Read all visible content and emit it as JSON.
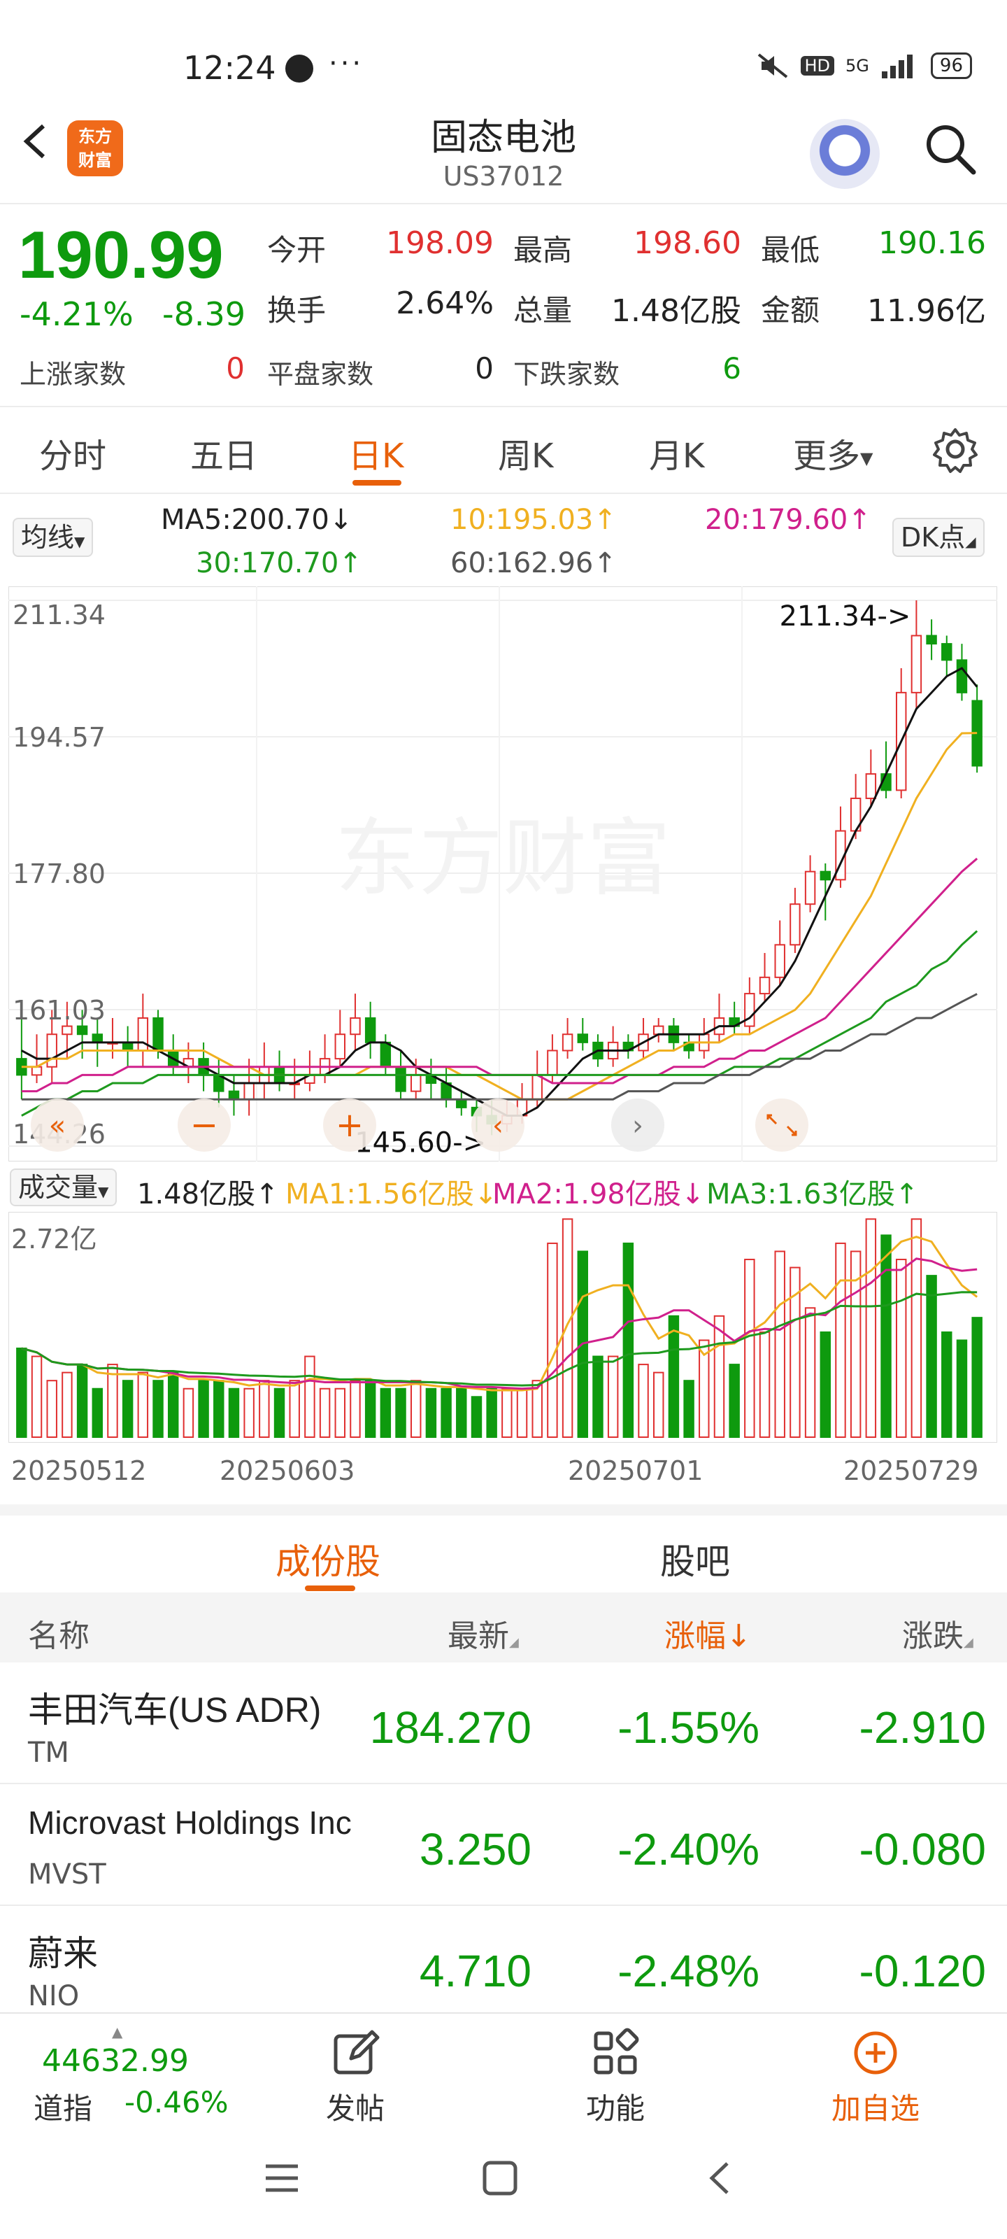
{
  "status": {
    "time": "12:24",
    "dots": "···",
    "hd": "HD",
    "network": "5G",
    "battery": "96"
  },
  "header": {
    "title": "固态电池",
    "code": "US37012",
    "logo_text": "东方财富"
  },
  "quote": {
    "price": "190.99",
    "change_pct": "-4.21%",
    "change": "-8.39",
    "open_label": "今开",
    "open": "198.09",
    "high_label": "最高",
    "high": "198.60",
    "low_label": "最低",
    "low": "190.16",
    "turnover_label": "换手",
    "turnover": "2.64%",
    "volume_label": "总量",
    "volume": "1.48亿股",
    "amount_label": "金额",
    "amount": "11.96亿",
    "up_label": "上涨家数",
    "up": "0",
    "flat_label": "平盘家数",
    "flat": "0",
    "down_label": "下跌家数",
    "down": "6"
  },
  "tabs": [
    "分时",
    "五日",
    "日K",
    "周K",
    "月K",
    "更多"
  ],
  "active_tab": "日K",
  "ma_legend": {
    "selector": "均线",
    "ma5": "MA5:200.70↓",
    "ma10": "10:195.03↑",
    "ma20": "20:179.60↑",
    "ma30": "30:170.70↑",
    "ma60": "60:162.96↑",
    "dk": "DK点"
  },
  "colors": {
    "up": "#e03030",
    "down": "#0e9a0e",
    "accent": "#e8600a",
    "ma5": "#111111",
    "ma10": "#f0b020",
    "ma20": "#d0208c",
    "ma30": "#1e9a1e",
    "ma60": "#555555"
  },
  "chart_data": [
    {
      "type": "candlestick",
      "y_ticks": [
        "211.34",
        "194.57",
        "177.80",
        "161.03",
        "144.26"
      ],
      "ylim": [
        144.26,
        211.34
      ],
      "x_ticks": [
        "20250512",
        "20250603",
        "20250701",
        "20250729"
      ],
      "annotations": {
        "high": "211.34->",
        "low": "145.60->"
      },
      "watermark": "东方财富",
      "candles": [
        [
          155,
          153,
          160,
          150
        ],
        [
          153,
          154,
          158,
          152
        ],
        [
          154,
          158,
          161,
          152
        ],
        [
          158,
          159,
          162,
          155
        ],
        [
          159,
          158,
          161,
          155
        ],
        [
          158,
          157,
          160,
          154
        ],
        [
          157,
          157,
          160,
          155
        ],
        [
          157,
          156,
          159,
          154
        ],
        [
          156,
          160,
          163,
          154
        ],
        [
          160,
          156,
          161,
          155
        ],
        [
          156,
          154,
          158,
          153
        ],
        [
          154,
          155,
          157,
          152
        ],
        [
          155,
          153,
          157,
          151
        ],
        [
          153,
          151,
          155,
          149
        ],
        [
          151,
          150,
          153,
          148
        ],
        [
          150,
          152,
          155,
          148
        ],
        [
          152,
          154,
          157,
          150
        ],
        [
          154,
          152,
          156,
          151
        ],
        [
          152,
          152,
          155,
          150
        ],
        [
          152,
          153,
          156,
          151
        ],
        [
          153,
          155,
          158,
          152
        ],
        [
          155,
          158,
          161,
          154
        ],
        [
          158,
          160,
          163,
          156
        ],
        [
          160,
          157,
          162,
          155
        ],
        [
          157,
          154,
          158,
          153
        ],
        [
          154,
          151,
          156,
          150
        ],
        [
          151,
          153,
          155,
          150
        ],
        [
          153,
          152,
          155,
          150
        ],
        [
          152,
          150,
          154,
          149
        ],
        [
          150,
          149,
          151,
          148
        ],
        [
          149,
          148,
          150,
          146
        ],
        [
          148,
          147,
          150,
          145.6
        ],
        [
          147,
          148,
          150,
          146
        ],
        [
          148,
          150,
          152,
          147
        ],
        [
          150,
          153,
          156,
          149
        ],
        [
          153,
          156,
          158,
          152
        ],
        [
          156,
          158,
          160,
          155
        ],
        [
          158,
          157,
          160,
          156
        ],
        [
          157,
          155,
          158,
          154
        ],
        [
          155,
          157,
          159,
          154
        ],
        [
          157,
          156,
          158,
          155
        ],
        [
          156,
          158,
          160,
          155
        ],
        [
          158,
          159,
          160,
          157
        ],
        [
          159,
          157,
          160,
          156
        ],
        [
          157,
          156,
          158,
          155
        ],
        [
          156,
          158,
          160,
          155
        ],
        [
          158,
          160,
          163,
          157
        ],
        [
          160,
          159,
          162,
          158
        ],
        [
          159,
          163,
          165,
          158
        ],
        [
          163,
          165,
          168,
          162
        ],
        [
          165,
          169,
          172,
          164
        ],
        [
          169,
          174,
          176,
          168
        ],
        [
          174,
          178,
          180,
          173
        ],
        [
          178,
          177,
          179,
          172
        ],
        [
          177,
          183,
          186,
          176
        ],
        [
          183,
          187,
          190,
          182
        ],
        [
          187,
          190,
          193,
          186
        ],
        [
          190,
          188,
          194,
          187
        ],
        [
          188,
          200,
          203,
          187
        ],
        [
          200,
          207,
          211.34,
          198
        ],
        [
          207,
          206,
          209,
          204
        ],
        [
          206,
          204,
          207,
          202
        ],
        [
          204,
          200,
          206,
          199
        ],
        [
          199,
          191,
          201,
          190.16
        ]
      ],
      "ma_lines": {
        "MA5": [
          156,
          155,
          155,
          156,
          157,
          157,
          157,
          157,
          157,
          156,
          155,
          154,
          154,
          153,
          152,
          152,
          152,
          152,
          152,
          153,
          153,
          154,
          156,
          157,
          157,
          156,
          154,
          153,
          152,
          151,
          150,
          149,
          148,
          148,
          149,
          151,
          153,
          155,
          156,
          156,
          156,
          157,
          158,
          158,
          158,
          158,
          159,
          159,
          160,
          162,
          164,
          167,
          171,
          175,
          179,
          183,
          186,
          190,
          194,
          198,
          200,
          202,
          203,
          200.7
        ],
        "MA10": [
          154,
          154,
          155,
          155,
          156,
          156,
          156,
          156,
          156,
          156,
          156,
          156,
          156,
          155,
          154,
          154,
          153,
          153,
          153,
          153,
          153,
          153,
          153,
          154,
          154,
          154,
          154,
          154,
          154,
          153,
          153,
          152,
          151,
          150,
          150,
          150,
          150,
          151,
          152,
          153,
          154,
          155,
          156,
          156,
          157,
          157,
          157,
          158,
          158,
          159,
          160,
          161,
          163,
          166,
          169,
          172,
          175,
          179,
          183,
          187,
          190,
          193,
          195,
          195.03
        ],
        "MA20": [
          151,
          151,
          152,
          152,
          153,
          153,
          153,
          154,
          154,
          154,
          154,
          154,
          154,
          154,
          154,
          154,
          154,
          154,
          154,
          154,
          154,
          154,
          154,
          154,
          154,
          154,
          154,
          154,
          154,
          154,
          154,
          153,
          153,
          153,
          153,
          152,
          152,
          152,
          152,
          152,
          153,
          153,
          153,
          154,
          154,
          154,
          155,
          155,
          156,
          156,
          157,
          158,
          159,
          160,
          162,
          164,
          166,
          168,
          170,
          172,
          174,
          176,
          178,
          179.6
        ],
        "MA30": [
          148,
          149,
          150,
          150,
          151,
          151,
          152,
          152,
          152,
          153,
          153,
          153,
          153,
          153,
          153,
          153,
          153,
          153,
          153,
          153,
          153,
          153,
          153,
          153,
          153,
          153,
          153,
          153,
          153,
          153,
          153,
          153,
          153,
          153,
          153,
          153,
          153,
          153,
          153,
          153,
          153,
          153,
          153,
          153,
          153,
          153,
          153,
          154,
          154,
          154,
          155,
          155,
          156,
          157,
          158,
          159,
          160,
          162,
          163,
          164,
          166,
          167,
          169,
          170.7
        ],
        "MA60": [
          150,
          150,
          150,
          150,
          150,
          150,
          150,
          150,
          150,
          150,
          150,
          150,
          150,
          150,
          150,
          150,
          150,
          150,
          150,
          150,
          150,
          150,
          150,
          150,
          150,
          150,
          150,
          150,
          150,
          150,
          150,
          150,
          150,
          150,
          150,
          150,
          150,
          150,
          150,
          150,
          151,
          151,
          151,
          152,
          152,
          152,
          153,
          153,
          153,
          154,
          154,
          155,
          155,
          156,
          156,
          157,
          158,
          158,
          159,
          160,
          160,
          161,
          162,
          162.96
        ]
      }
    },
    {
      "type": "bar",
      "title": "成交量",
      "y_ticks": [
        "2.72亿"
      ],
      "ylim": [
        0,
        2.72
      ],
      "values": [
        1.1,
        1.0,
        0.7,
        0.8,
        0.9,
        0.6,
        0.9,
        0.7,
        0.8,
        0.7,
        0.8,
        0.6,
        0.7,
        0.7,
        0.6,
        0.6,
        0.7,
        0.6,
        0.7,
        1.0,
        0.6,
        0.6,
        0.7,
        0.7,
        0.6,
        0.6,
        0.7,
        0.6,
        0.6,
        0.6,
        0.5,
        0.6,
        0.6,
        0.6,
        0.7,
        2.4,
        2.7,
        2.3,
        1.0,
        1.0,
        2.4,
        0.9,
        0.8,
        1.5,
        0.7,
        1.2,
        1.5,
        0.9,
        2.2,
        1.3,
        2.3,
        2.1,
        1.6,
        1.3,
        2.4,
        2.3,
        2.7,
        2.5,
        2.2,
        2.7,
        2.0,
        1.3,
        1.2,
        1.48
      ]
    }
  ],
  "vol_legend": {
    "label": "成交量",
    "vol": "1.48亿股↑",
    "ma1": "MA1:1.56亿股↓",
    "ma2": "MA2:1.98亿股↓",
    "ma3": "MA3:1.63亿股↑"
  },
  "section_tabs": [
    "成份股",
    "股吧"
  ],
  "table": {
    "headers": {
      "name": "名称",
      "latest": "最新",
      "pct": "涨幅",
      "chg": "涨跌"
    },
    "rows": [
      {
        "name": "丰田汽车(US ADR)",
        "code": "TM",
        "latest": "184.270",
        "pct": "-1.55%",
        "chg": "-2.910"
      },
      {
        "name": "Microvast Holdings Inc",
        "code": "MVST",
        "latest": "3.250",
        "pct": "-2.40%",
        "chg": "-0.080"
      },
      {
        "name": "蔚来",
        "code": "NIO",
        "latest": "4.710",
        "pct": "-2.48%",
        "chg": "-0.120"
      }
    ]
  },
  "bottom_bar": {
    "index_value": "44632.99",
    "index_name": "道指",
    "index_pct": "-0.46%",
    "post": "发帖",
    "func": "功能",
    "add": "加自选"
  }
}
